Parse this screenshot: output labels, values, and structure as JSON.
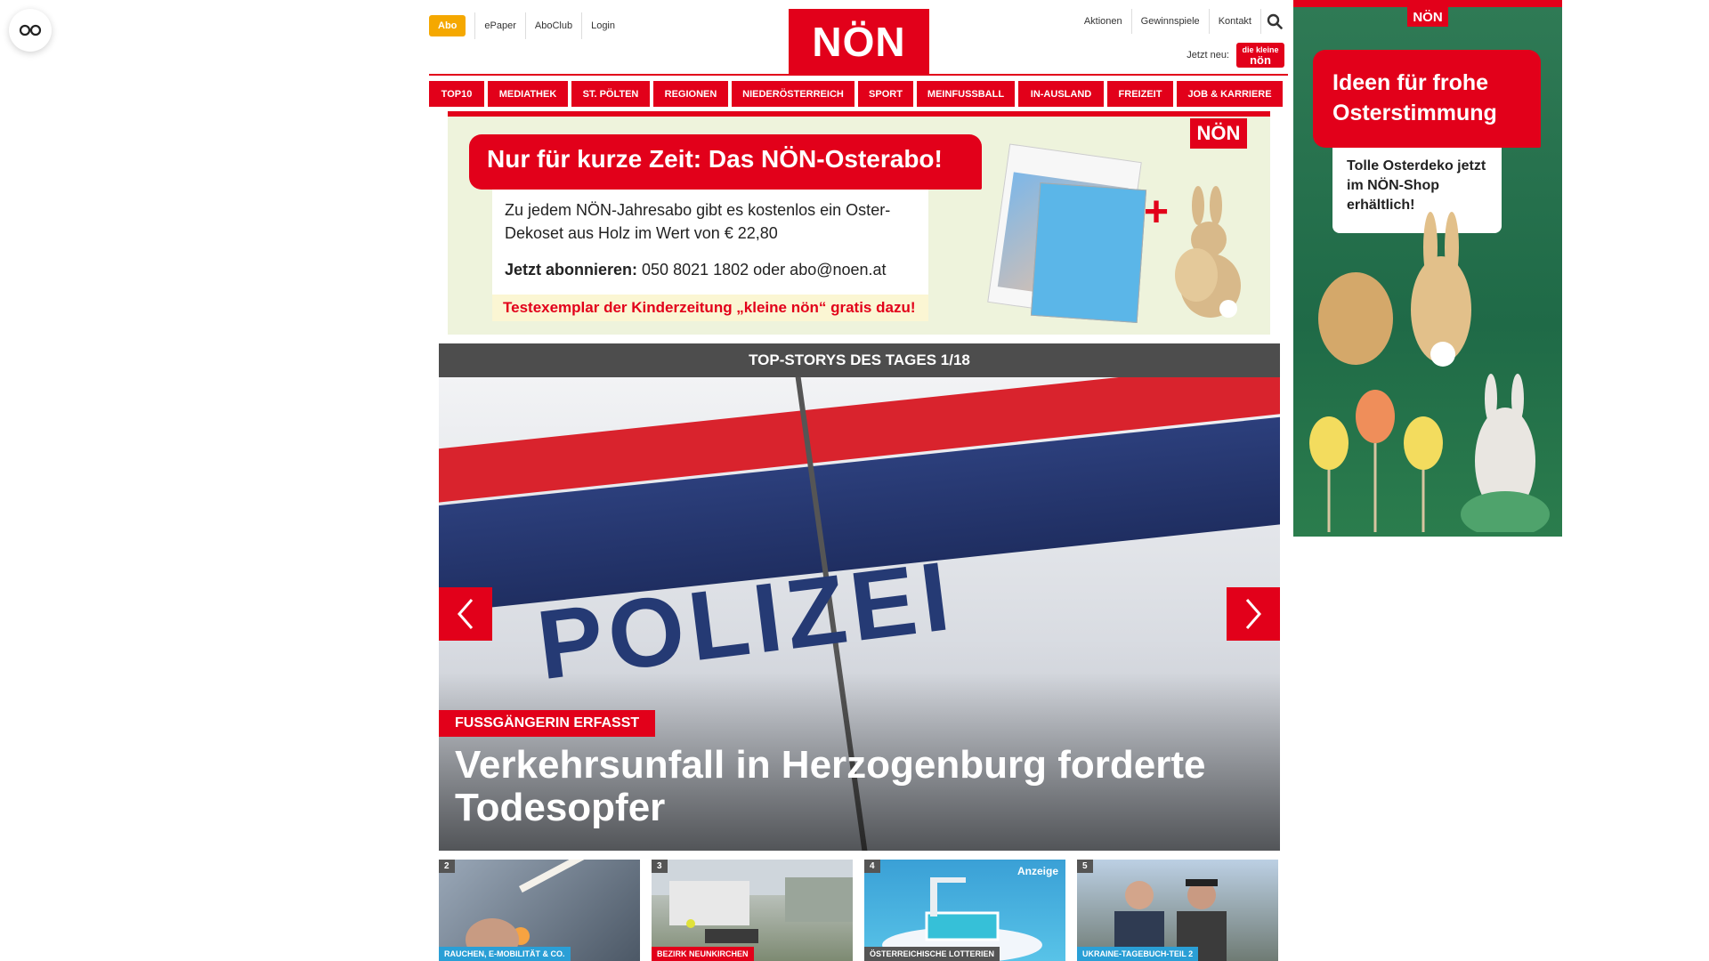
{
  "topbar": {
    "abo": "Abo",
    "links": [
      "ePaper",
      "AboClub",
      "Login"
    ],
    "right_links": [
      "Aktionen",
      "Gewinnspiele",
      "Kontakt"
    ],
    "jetzt_neu": "Jetzt neu:",
    "kleine_logo_line1": "die kleine",
    "kleine_logo_line2": "nön"
  },
  "logo": "NÖN",
  "nav": [
    "TOP10",
    "MEDIATHEK",
    "ST. PÖLTEN",
    "REGIONEN",
    "NIEDERÖSTERREICH",
    "SPORT",
    "MEINFUSSBALL",
    "IN-AUSLAND",
    "FREIZEIT",
    "JOB & KARRIERE"
  ],
  "promo": {
    "badge": "NÖN",
    "headline": "Nur für kurze Zeit: Das NÖN-Osterabo!",
    "text1": "Zu jedem NÖN-Jahresabo gibt es kostenlos ein Oster-Dekoset aus Holz im Wert von € 22,80",
    "text2_bold": "Jetzt abonnieren:",
    "text2_rest": " 050 8021 1802 oder abo@noen.at",
    "text3": "Testexemplar der Kinderzeitung „kleine nön“ gratis dazu!",
    "plus": "+"
  },
  "stories": {
    "bar": "TOP-STORYS DES TAGES 1/18",
    "polizei": "POLIZEI",
    "tag": "FUSSGÄNGERIN ERFASST",
    "title": "Verkehrsunfall in Herzogenburg forderte Todesopfer"
  },
  "thumbs": [
    {
      "num": "2",
      "cat": "RAUCHEN, E-MOBILITÄT & CO.",
      "cat_color": "#2a9fd6"
    },
    {
      "num": "3",
      "cat": "BEZIRK NEUNKIRCHEN",
      "cat_color": "#e2001a"
    },
    {
      "num": "4",
      "cat": "ÖSTERREICHISCHE LOTTERIEN",
      "cat_color": "#555555",
      "anzeige": "Anzeige"
    },
    {
      "num": "5",
      "cat": "UKRAINE-TAGEBUCH-TEIL 2",
      "cat_color": "#2a9fd6"
    }
  ],
  "ad": {
    "logo": "NÖN",
    "headline": "Ideen für frohe Osterstimmung",
    "sub": "Tolle Osterdeko jetzt im NÖN-Shop erhältlich!"
  },
  "colors": {
    "brand_red": "#e2001a",
    "abo_orange": "#f5a800",
    "ad_green": "#2f7a55"
  }
}
